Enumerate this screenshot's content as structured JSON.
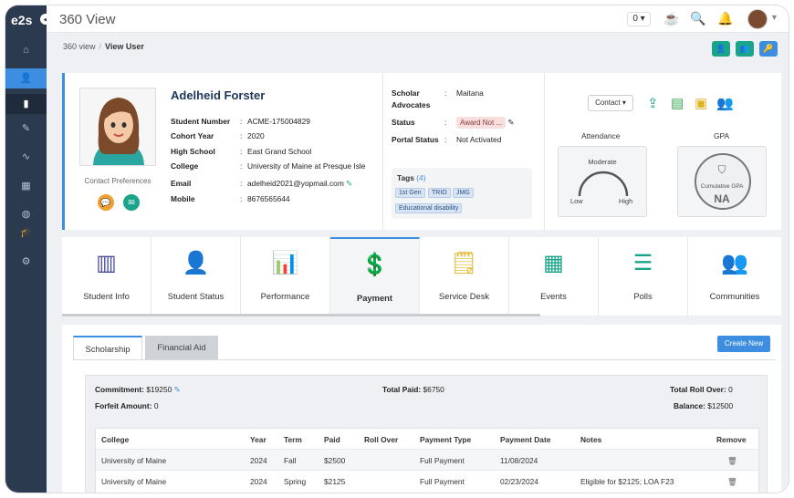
{
  "app": {
    "logo": "e2s",
    "title": "360 View",
    "notification_count": "0"
  },
  "sidebar": {
    "items": [
      "home-icon",
      "user-icon",
      "mobile-icon",
      "edit-icon",
      "chart-icon",
      "calendar-icon",
      "globe-icon",
      "graduation-cap-icon",
      "gear-icon"
    ]
  },
  "breadcrumb": {
    "root": "360 view",
    "separator": "/",
    "current": "View User"
  },
  "profile": {
    "name": "Adelheid Forster",
    "contact_preferences": "Contact Preferences",
    "fields": [
      {
        "k": "Student Number",
        "v": "ACME-175004829"
      },
      {
        "k": "Cohort Year",
        "v": "2020"
      },
      {
        "k": "High School",
        "v": "East Grand School"
      },
      {
        "k": "College",
        "v": "University of Maine at Presque Isle"
      },
      {
        "k": "Email",
        "v": "adelheid2021@yopmail.com"
      },
      {
        "k": "Mobile",
        "v": "8676565644"
      }
    ],
    "scholar_advocates_label": "Scholar Advocates",
    "scholar_advocates_value": "Maitana",
    "status_label": "Status",
    "status_value": "Award Not ...",
    "portal_status_label": "Portal Status",
    "portal_status_value": "Not Activated",
    "tags_label": "Tags",
    "tags_count": "(4)",
    "tags": [
      "1st Gen",
      "TRIO",
      "JMG",
      "Educational disability"
    ],
    "contact_dropdown": "Contact",
    "attendance_label": "Attendance",
    "attendance_level": "Moderate",
    "attendance_low": "Low",
    "attendance_high": "High",
    "gpa_label": "GPA",
    "gpa_caption": "Cumulative GPA",
    "gpa_value": "NA"
  },
  "tiles": [
    {
      "label": "Student Info",
      "icon": "contact-book-icon"
    },
    {
      "label": "Student Status",
      "icon": "user-info-icon"
    },
    {
      "label": "Performance",
      "icon": "bar-chart-icon"
    },
    {
      "label": "Payment",
      "icon": "money-hand-icon"
    },
    {
      "label": "Service Desk",
      "icon": "note-icon"
    },
    {
      "label": "Events",
      "icon": "calendar-grid-icon"
    },
    {
      "label": "Polls",
      "icon": "poll-list-icon"
    },
    {
      "label": "Communities",
      "icon": "community-icon"
    }
  ],
  "payment": {
    "tabs": [
      "Scholarship",
      "Financial Aid"
    ],
    "create_new": "Create New",
    "commitment_label": "Commitment:",
    "commitment_value": "$19250",
    "total_paid_label": "Total Paid:",
    "total_paid_value": "$6750",
    "total_rollover_label": "Total Roll Over:",
    "total_rollover_value": "0",
    "forfeit_label": "Forfeit Amount:",
    "forfeit_value": "0",
    "balance_label": "Balance:",
    "balance_value": "$12500",
    "columns": [
      "College",
      "Year",
      "Term",
      "Paid",
      "Roll Over",
      "Payment Type",
      "Payment Date",
      "Notes",
      "Remove"
    ],
    "rows": [
      [
        "University of Maine",
        "2024",
        "Fall",
        "$2500",
        "",
        "Full Payment",
        "11/08/2024",
        ""
      ],
      [
        "University of Maine",
        "2024",
        "Spring",
        "$2125",
        "",
        "Full Payment",
        "02/23/2024",
        "Eligible for $2125; LOA F23"
      ]
    ]
  }
}
